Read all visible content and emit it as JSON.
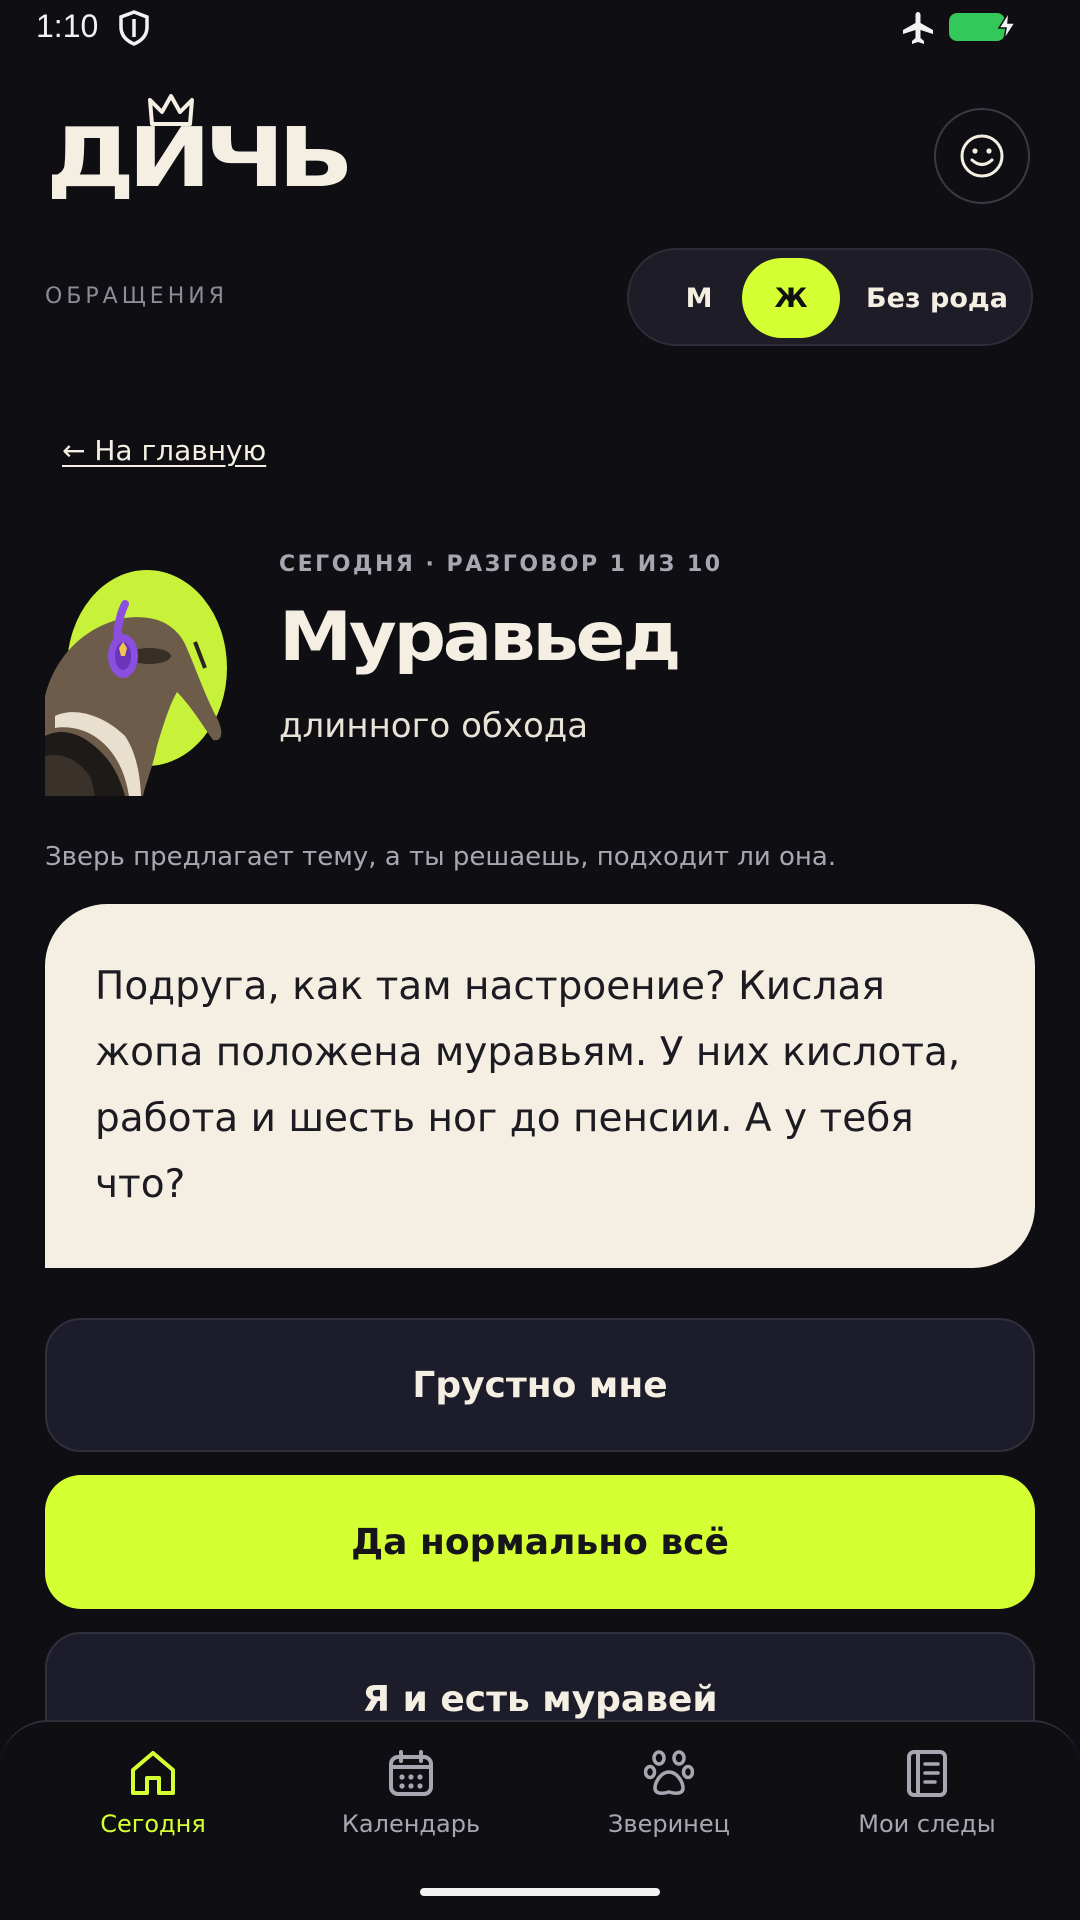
{
  "status_bar": {
    "time": "1:10"
  },
  "header": {
    "logo_text": "ДИЧЬ"
  },
  "address_section": {
    "label": "ОБРАЩЕНИЯ",
    "options": [
      "М",
      "Ж",
      "Без рода"
    ],
    "selected": "Ж"
  },
  "back_link": "← На главную",
  "conversation": {
    "eyebrow": "СЕГОДНЯ · РАЗГОВОР 1 ИЗ 10",
    "animal_name": "Муравьед",
    "animal_subtitle": "длинного обхода",
    "hint": "Зверь предлагает тему, а ты решаешь, подходит ли она.",
    "message": "Подруга, как там настроение? Кислая жопа положена муравьям. У них кислота, работа и шесть ног до пенсии. А у тебя что?"
  },
  "answers": [
    {
      "label": "Грустно мне",
      "style": "dark"
    },
    {
      "label": "Да нормально всё",
      "style": "lime"
    },
    {
      "label": "Я и есть муравей",
      "style": "dark"
    }
  ],
  "bottom_nav": [
    {
      "label": "Сегодня",
      "icon": "home-icon",
      "active": true
    },
    {
      "label": "Календарь",
      "icon": "calendar-icon",
      "active": false
    },
    {
      "label": "Зверинец",
      "icon": "paw-icon",
      "active": false
    },
    {
      "label": "Мои следы",
      "icon": "notebook-icon",
      "active": false
    }
  ],
  "colors": {
    "background": "#0f0e13",
    "accent_lime": "#d4ff33",
    "cream": "#f4efe2",
    "muted_text": "#a9a6b2",
    "card_dark": "#1d1c2b",
    "battery": "#34c759"
  }
}
